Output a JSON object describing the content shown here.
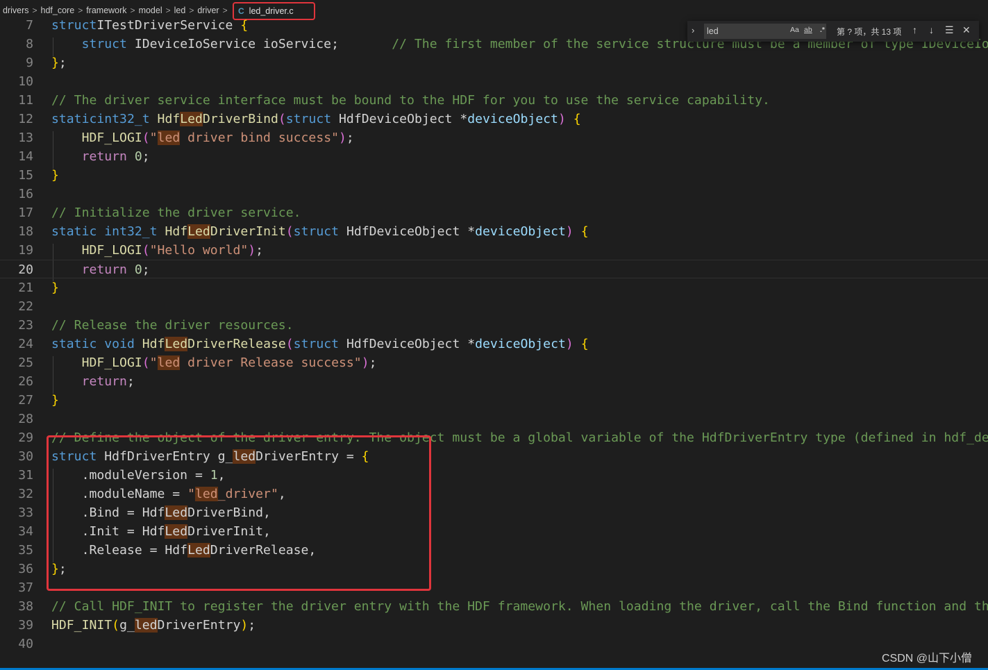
{
  "breadcrumb": {
    "items": [
      "drivers",
      "hdf_core",
      "framework",
      "model",
      "led",
      "driver"
    ],
    "file_icon": "C",
    "file": "led_driver.c"
  },
  "find": {
    "query": "led",
    "match_case": "Aa",
    "whole_word": "ab",
    "regex": ".*",
    "count": "第 ? 项，共 13 项",
    "prev_icon": "arrow-up-icon",
    "next_icon": "arrow-down-icon",
    "selection_icon": "find-in-selection-icon",
    "close_icon": "close-icon"
  },
  "editor": {
    "current_line": 20,
    "lines": [
      {
        "n": "7",
        "t": [
          [
            "kw",
            "struct"
          ],
          [
            "",
            "ITestDriverService "
          ],
          [
            "b1",
            "{"
          ]
        ]
      },
      {
        "n": "8",
        "t": [
          [
            "",
            "    "
          ],
          [
            "kw",
            "struct"
          ],
          [
            "",
            " IDeviceIoService ioService;       "
          ],
          [
            "cmt",
            "// The first member of the service structure must be a member of type IDeviceIoService."
          ]
        ]
      },
      {
        "n": "9",
        "t": [
          [
            "b1",
            "}"
          ],
          [
            "",
            ";"
          ]
        ]
      },
      {
        "n": "10",
        "t": []
      },
      {
        "n": "11",
        "t": [
          [
            "cmt",
            "// The driver service interface must be bound to the HDF for you to use the service capability."
          ]
        ]
      },
      {
        "n": "12",
        "t": [
          [
            "kw",
            "static"
          ],
          [
            "",
            "",
            " "
          ],
          [
            "kw",
            "int32_t"
          ],
          [
            "",
            " "
          ],
          [
            "fn",
            "Hdf"
          ],
          [
            "fn hl",
            "Led"
          ],
          [
            "fn",
            "DriverBind"
          ],
          [
            "b2",
            "("
          ],
          [
            "kw",
            "struct"
          ],
          [
            "",
            " HdfDeviceObject *"
          ],
          [
            "param",
            "deviceObject"
          ],
          [
            "b2",
            ")"
          ],
          [
            "",
            " "
          ],
          [
            "b1",
            "{"
          ]
        ]
      },
      {
        "n": "13",
        "t": [
          [
            "",
            "    "
          ],
          [
            "fn",
            "HDF_LOGI"
          ],
          [
            "b2",
            "("
          ],
          [
            "str",
            "\""
          ],
          [
            "str hl",
            "led"
          ],
          [
            "str",
            " driver bind success\""
          ],
          [
            "b2",
            ")"
          ],
          [
            "",
            ";"
          ]
        ]
      },
      {
        "n": "14",
        "t": [
          [
            "",
            "    "
          ],
          [
            "ctl",
            "return"
          ],
          [
            "",
            " "
          ],
          [
            "num",
            "0"
          ],
          [
            "",
            ";"
          ]
        ]
      },
      {
        "n": "15",
        "t": [
          [
            "b1",
            "}"
          ]
        ]
      },
      {
        "n": "16",
        "t": []
      },
      {
        "n": "17",
        "t": [
          [
            "cmt",
            "// Initialize the driver service."
          ]
        ]
      },
      {
        "n": "18",
        "t": [
          [
            "kw",
            "static"
          ],
          [
            "",
            " "
          ],
          [
            "kw",
            "int32_t"
          ],
          [
            "",
            " "
          ],
          [
            "fn",
            "Hdf"
          ],
          [
            "fn hl",
            "Led"
          ],
          [
            "fn",
            "DriverInit"
          ],
          [
            "b2",
            "("
          ],
          [
            "kw",
            "struct"
          ],
          [
            "",
            " HdfDeviceObject *"
          ],
          [
            "param",
            "deviceObject"
          ],
          [
            "b2",
            ")"
          ],
          [
            "",
            " "
          ],
          [
            "b1",
            "{"
          ]
        ]
      },
      {
        "n": "19",
        "t": [
          [
            "",
            "    "
          ],
          [
            "fn",
            "HDF_LOGI"
          ],
          [
            "b2",
            "("
          ],
          [
            "str",
            "\"Hello world\""
          ],
          [
            "b2",
            ")"
          ],
          [
            "",
            ";"
          ]
        ]
      },
      {
        "n": "20",
        "t": [
          [
            "",
            "    "
          ],
          [
            "ctl",
            "return"
          ],
          [
            "",
            " "
          ],
          [
            "num",
            "0"
          ],
          [
            "",
            ";"
          ]
        ]
      },
      {
        "n": "21",
        "t": [
          [
            "b1",
            "}"
          ]
        ]
      },
      {
        "n": "22",
        "t": []
      },
      {
        "n": "23",
        "t": [
          [
            "cmt",
            "// Release the driver resources."
          ]
        ]
      },
      {
        "n": "24",
        "t": [
          [
            "kw",
            "static"
          ],
          [
            "",
            " "
          ],
          [
            "kw",
            "void"
          ],
          [
            "",
            " "
          ],
          [
            "fn",
            "Hdf"
          ],
          [
            "fn hl",
            "Led"
          ],
          [
            "fn",
            "DriverRelease"
          ],
          [
            "b2",
            "("
          ],
          [
            "kw",
            "struct"
          ],
          [
            "",
            " HdfDeviceObject *"
          ],
          [
            "param",
            "deviceObject"
          ],
          [
            "b2",
            ")"
          ],
          [
            "",
            " "
          ],
          [
            "b1",
            "{"
          ]
        ]
      },
      {
        "n": "25",
        "t": [
          [
            "",
            "    "
          ],
          [
            "fn",
            "HDF_LOGI"
          ],
          [
            "b2",
            "("
          ],
          [
            "str",
            "\""
          ],
          [
            "str hl",
            "led"
          ],
          [
            "str",
            " driver Release success\""
          ],
          [
            "b2",
            ")"
          ],
          [
            "",
            ";"
          ]
        ]
      },
      {
        "n": "26",
        "t": [
          [
            "",
            "    "
          ],
          [
            "ctl",
            "return"
          ],
          [
            "",
            ";"
          ]
        ]
      },
      {
        "n": "27",
        "t": [
          [
            "b1",
            "}"
          ]
        ]
      },
      {
        "n": "28",
        "t": []
      },
      {
        "n": "29",
        "t": [
          [
            "cmt",
            "// Define the object of the driver entry. The object must be a global variable of the HdfDriverEntry type (defined in hdf_device_desc.h)."
          ]
        ]
      },
      {
        "n": "30",
        "t": [
          [
            "kw",
            "struct"
          ],
          [
            "",
            " HdfDriverEntry g_"
          ],
          [
            "hl",
            "led"
          ],
          [
            "",
            "DriverEntry = "
          ],
          [
            "b1",
            "{"
          ]
        ]
      },
      {
        "n": "31",
        "t": [
          [
            "",
            "    .moduleVersion = "
          ],
          [
            "num",
            "1"
          ],
          [
            "",
            ","
          ]
        ]
      },
      {
        "n": "32",
        "t": [
          [
            "",
            "    .moduleName = "
          ],
          [
            "str",
            "\""
          ],
          [
            "str hl",
            "led"
          ],
          [
            "str",
            "_driver\""
          ],
          [
            "",
            ","
          ]
        ]
      },
      {
        "n": "33",
        "t": [
          [
            "",
            "    .Bind = Hdf"
          ],
          [
            "hl",
            "Led"
          ],
          [
            "",
            "DriverBind,"
          ]
        ]
      },
      {
        "n": "34",
        "t": [
          [
            "",
            "    .Init = Hdf"
          ],
          [
            "hl",
            "Led"
          ],
          [
            "",
            "DriverInit,"
          ]
        ]
      },
      {
        "n": "35",
        "t": [
          [
            "",
            "    .Release = Hdf"
          ],
          [
            "hl",
            "Led"
          ],
          [
            "",
            "DriverRelease,"
          ]
        ]
      },
      {
        "n": "36",
        "t": [
          [
            "b1",
            "}"
          ],
          [
            "",
            ";"
          ]
        ]
      },
      {
        "n": "37",
        "t": []
      },
      {
        "n": "38",
        "t": [
          [
            "cmt",
            "// Call HDF_INIT to register the driver entry with the HDF framework. When loading the driver, call the Bind function and then the Init function."
          ]
        ]
      },
      {
        "n": "39",
        "t": [
          [
            "fn",
            "HDF_INIT"
          ],
          [
            "b1",
            "("
          ],
          [
            "",
            "g_"
          ],
          [
            "hl",
            "led"
          ],
          [
            "",
            "DriverEntry"
          ],
          [
            "b1",
            ")"
          ],
          [
            "",
            ";"
          ]
        ]
      },
      {
        "n": "40",
        "t": []
      }
    ]
  },
  "watermark": "CSDN @山下小僧"
}
